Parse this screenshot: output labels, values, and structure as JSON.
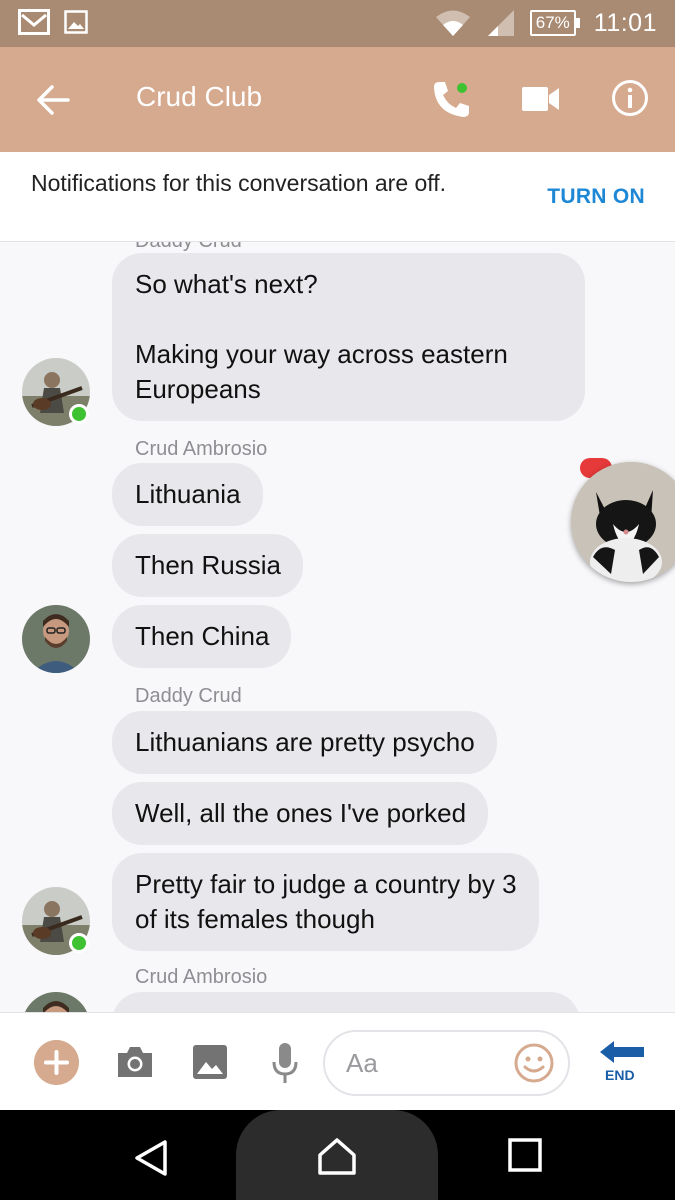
{
  "status_bar": {
    "battery": "67%",
    "time": "11:01"
  },
  "header": {
    "title": "Crud Club"
  },
  "notification": {
    "text": "Notifications for this conversation are off.",
    "action": "TURN ON"
  },
  "messages": {
    "cutoff_sender": "Daddy Crud",
    "groups": [
      {
        "sender": "",
        "online": true,
        "bubbles": [
          "So what's next?\n\nMaking your way across eastern Europeans"
        ]
      },
      {
        "sender": "Crud Ambrosio",
        "online": false,
        "bubbles": [
          "Lithuania",
          "Then Russia",
          "Then China"
        ]
      },
      {
        "sender": "Daddy Crud",
        "online": true,
        "bubbles": [
          "Lithuanians are pretty psycho",
          "Well, all the ones I've porked",
          "Pretty fair to judge a country by 3\nof its females though"
        ]
      },
      {
        "sender": "Crud Ambrosio",
        "online": false,
        "bubbles": []
      }
    ]
  },
  "composer": {
    "placeholder": "Aa",
    "end_label": "END"
  },
  "colors": {
    "status_bar": "#a98a72",
    "app_bar": "#d6aa8f",
    "accent_blue": "#1e88d6",
    "bubble": "#e8e8ec",
    "online": "#3ec232"
  },
  "icons": {
    "back": "arrow-left-icon",
    "call": "phone-icon",
    "video": "video-camera-icon",
    "info": "info-icon",
    "plus": "plus-icon",
    "camera": "camera-icon",
    "gallery": "image-icon",
    "mic": "microphone-icon",
    "emoji": "smiley-icon",
    "end": "end-arrow-icon"
  }
}
